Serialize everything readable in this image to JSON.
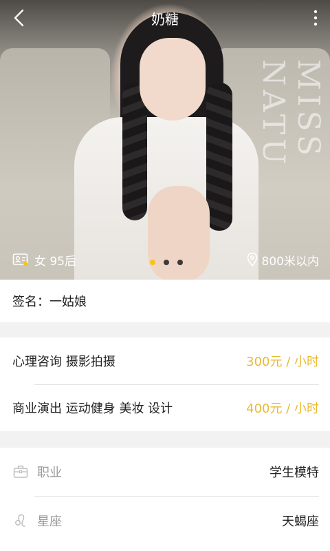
{
  "header": {
    "title": "奶糖"
  },
  "hero": {
    "watermark": "MISS NATU",
    "gender_age": "女 95后",
    "distance": "800米以内",
    "carousel": {
      "count": 3,
      "active_index": 0
    }
  },
  "signature": {
    "label": "签名：",
    "value": "一姑娘"
  },
  "services": [
    {
      "name": "心理咨询  摄影拍摄",
      "price": "300元 / 小时"
    },
    {
      "name": "商业演出 运动健身 美妆 设计",
      "price": "400元 / 小时"
    }
  ],
  "details": [
    {
      "icon": "briefcase-icon",
      "label": "职业",
      "value": "学生模特"
    },
    {
      "icon": "leo-zodiac-icon",
      "label": "星座",
      "value": "天蝎座"
    }
  ],
  "colors": {
    "accent": "#f5c518",
    "price": "#e9b934",
    "label_gray": "#9a9a9a"
  }
}
